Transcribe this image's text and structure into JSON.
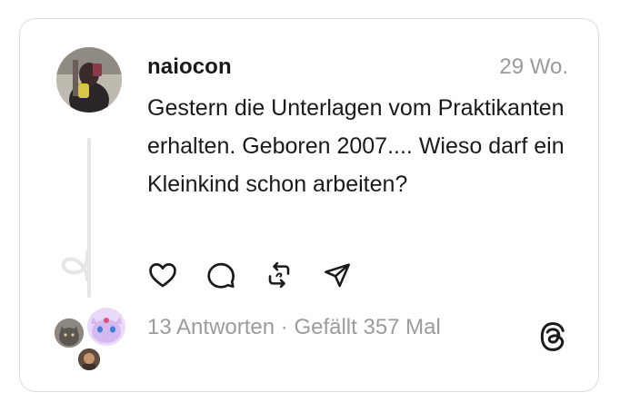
{
  "post": {
    "username": "naiocon",
    "timestamp": "29 Wo.",
    "text": "Gestern die Unterlagen vom Praktikanten erhalten. Geboren 2007.... Wieso darf ein Kleinkind schon arbeiten?"
  },
  "actions": {
    "like_icon": "heart-icon",
    "reply_icon": "comment-icon",
    "repost_icon": "repost-icon",
    "share_icon": "send-icon"
  },
  "stats": {
    "replies": "13 Antworten",
    "separator": " · ",
    "likes": "Gefällt 357 Mal"
  },
  "colors": {
    "text": "#1a1a1a",
    "muted": "#9b9b9b",
    "border": "#dcdcdc",
    "thread_line": "#e6e6e6"
  }
}
